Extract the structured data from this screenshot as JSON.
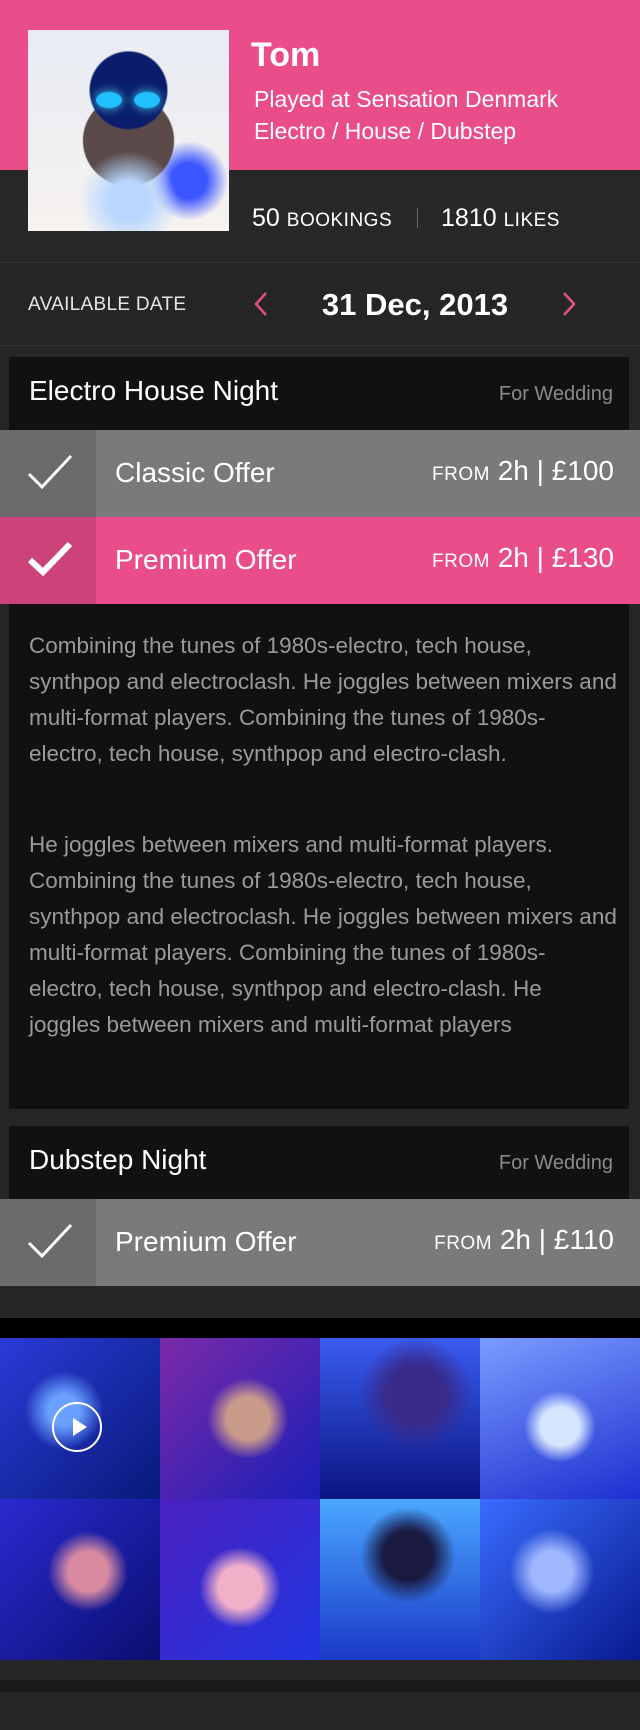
{
  "profile": {
    "name": "Tom",
    "played_at": "Played at Sensation Denmark",
    "genres": "Electro / House / Dubstep",
    "bookings_count": "50",
    "bookings_label": "BOOKINGS",
    "likes_count": "1810",
    "likes_label": "LIKES"
  },
  "date_picker": {
    "label": "AVAILABLE DATE",
    "value": "31 Dec, 2013",
    "prev_icon": "chevron-left-icon",
    "next_icon": "chevron-right-icon"
  },
  "events": [
    {
      "title": "Electro House Night",
      "tag": "For Wedding",
      "offers": [
        {
          "name": "Classic Offer",
          "from": "FROM",
          "price": "2h | £100",
          "selected": false
        },
        {
          "name": "Premium Offer",
          "from": "FROM",
          "price": "2h | £130",
          "selected": true
        }
      ],
      "description": [
        "Combining the tunes of 1980s-electro, tech house, synthpop and electroclash. He joggles between mixers and multi-format players. Combining the tunes of 1980s-electro, tech house, synthpop and electro-clash.",
        "He joggles between mixers and multi-format players. Combining the tunes of 1980s-electro, tech house, synthpop and electroclash. He joggles between mixers and multi-format players. Combining the tunes of 1980s-electro, tech house, synthpop and electro-clash. He joggles between mixers and multi-format players"
      ]
    },
    {
      "title": "Dubstep Night",
      "tag": "For Wedding",
      "offers": [
        {
          "name": "Premium Offer",
          "from": "FROM",
          "price": "2h | £110",
          "selected": false
        }
      ]
    }
  ],
  "colors": {
    "accent": "#e94d8a",
    "offer_grey": "#7a7a7a",
    "card_bg": "#111111",
    "page_bg": "#262626"
  }
}
